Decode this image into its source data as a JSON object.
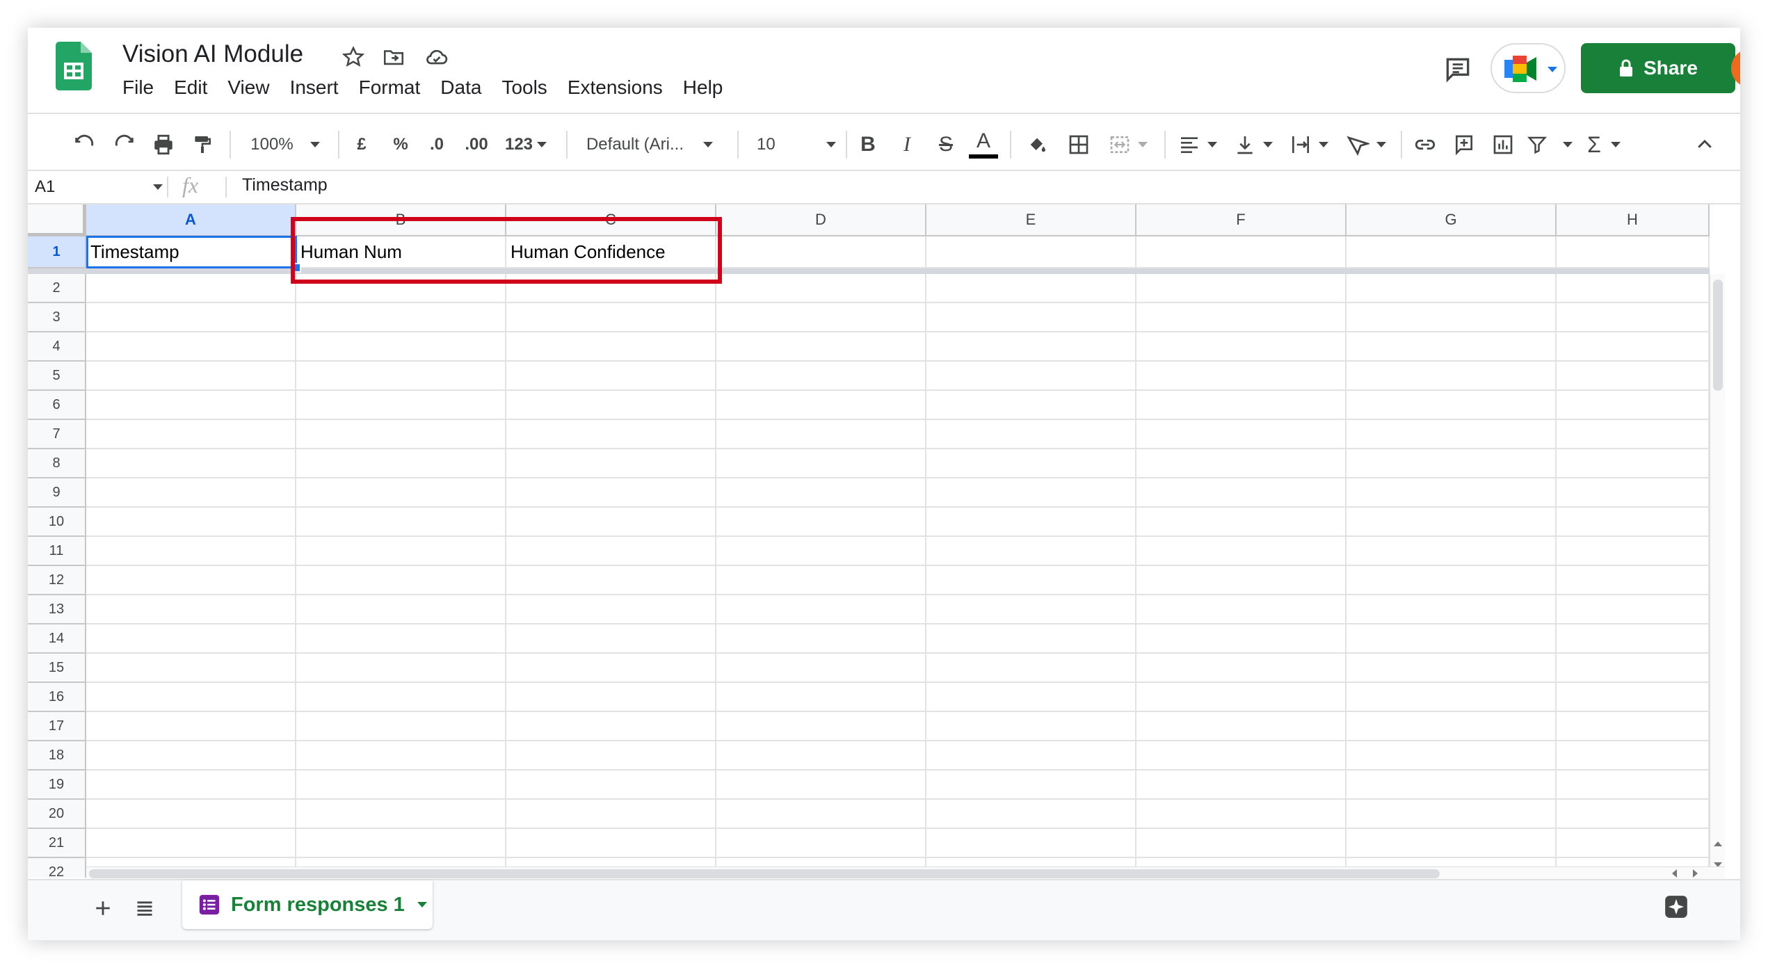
{
  "doc": {
    "title": "Vision AI Module"
  },
  "menu": [
    "File",
    "Edit",
    "View",
    "Insert",
    "Format",
    "Data",
    "Tools",
    "Extensions",
    "Help"
  ],
  "header": {
    "share_label": "Share"
  },
  "toolbar": {
    "zoom": "100%",
    "currency": "£",
    "percent": "%",
    "decrease_decimal": ".0",
    "increase_decimal": ".00",
    "number_format": "123",
    "font": "Default (Ari...",
    "font_size": "10",
    "bold": "B",
    "italic": "I",
    "strike": "S",
    "text_color": "A",
    "function": "Σ"
  },
  "formula_bar": {
    "cell_ref": "A1",
    "fx": "fx",
    "content": "Timestamp"
  },
  "grid": {
    "columns": [
      "A",
      "B",
      "C",
      "D",
      "E",
      "F",
      "G",
      "H"
    ],
    "rows": [
      "1",
      "2",
      "3",
      "4",
      "5",
      "6",
      "7",
      "8",
      "9",
      "10",
      "11",
      "12",
      "13",
      "14",
      "15",
      "16",
      "17",
      "18",
      "19",
      "20",
      "21",
      "22"
    ],
    "row1": [
      "Timestamp",
      "Human Num",
      "Human Confidence"
    ],
    "selected_cell": "A1"
  },
  "sheets": {
    "active": "Form responses 1"
  },
  "colors": {
    "share_green": "#188038",
    "selection_blue": "#1a73e8",
    "highlight_red": "#d0021b",
    "sheet_tab_purple": "#7b1fa2"
  }
}
